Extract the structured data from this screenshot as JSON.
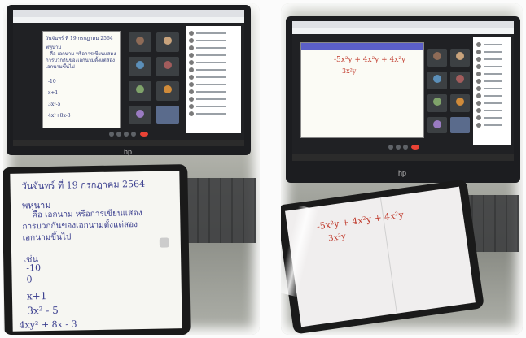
{
  "left_photo": {
    "laptop_notes": {
      "date": "วันจันทร์ ที่ 19 กรกฎาคม 2564",
      "topic": "พหุนาม",
      "lines": [
        "คือ เอกนาม หรือการเขียนแสดง",
        "การบวกกันของเอกนามตั้งแต่สอง",
        "เอกนามขึ้นไป"
      ],
      "examples": [
        "-10",
        "x+1",
        "3x²-5",
        "4x²+8x-3"
      ]
    },
    "tablet_notes": {
      "date": "วันจันทร์ ที่ 19 กรกฎาคม 2564",
      "topic": "พหุนาม",
      "lines": [
        "คือ เอกนาม หรือการเขียนแสดง",
        "การบวกกันของเอกนามตั้งแต่สอง",
        "เอกนามขึ้นไป"
      ],
      "example_label": "เช่น",
      "examples": [
        "-10",
        "0",
        "x+1",
        "3x² - 5",
        "4xy² + 8x - 3"
      ]
    },
    "brand": "hp"
  },
  "right_photo": {
    "board_expression": "-5x²y + 4x²y + 4x²y",
    "board_result": "3x²y",
    "brand": "hp"
  },
  "colors": {
    "ink": "#3b3f8f",
    "red_ink": "#c0392b",
    "meet_dark": "#202124",
    "end_call": "#ea4335"
  }
}
